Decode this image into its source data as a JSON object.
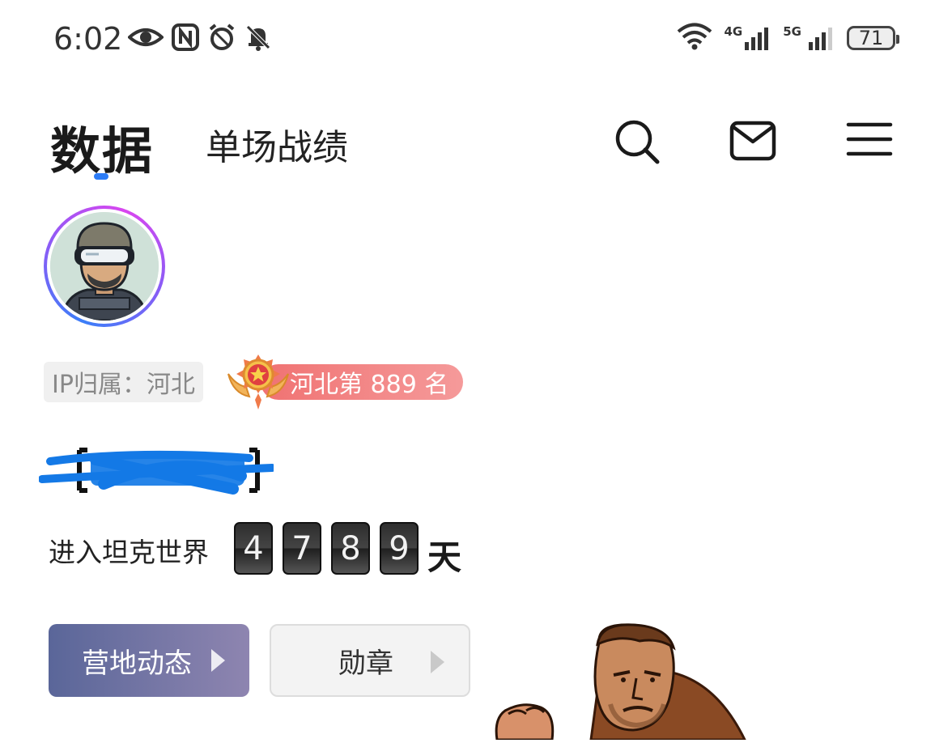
{
  "status_bar": {
    "time": "6:02",
    "left_icons": [
      "eye-icon",
      "nfc-icon",
      "alarm-icon",
      "mute-icon"
    ],
    "right_icons": [
      "wifi-icon",
      "signal-4g-icon",
      "signal-5g-icon",
      "battery-icon"
    ],
    "network_1": "4G",
    "network_2": "5G",
    "battery": "71"
  },
  "header": {
    "tab_active": "数据",
    "tab_other": "单场战绩",
    "icons": [
      "search-icon",
      "mail-icon",
      "menu-icon"
    ],
    "accent_color": "#2d7cf6"
  },
  "profile": {
    "ip_label": "IP归属：河北",
    "rank_text": "河北第 889 名",
    "rank_color": "#f07272",
    "name_redacted": true
  },
  "tank_days": {
    "label": "进入坦克世界",
    "digits": [
      "4",
      "7",
      "8",
      "9"
    ],
    "unit": "天"
  },
  "buttons": {
    "camp_label": "营地动态",
    "medal_label": "勋章"
  }
}
